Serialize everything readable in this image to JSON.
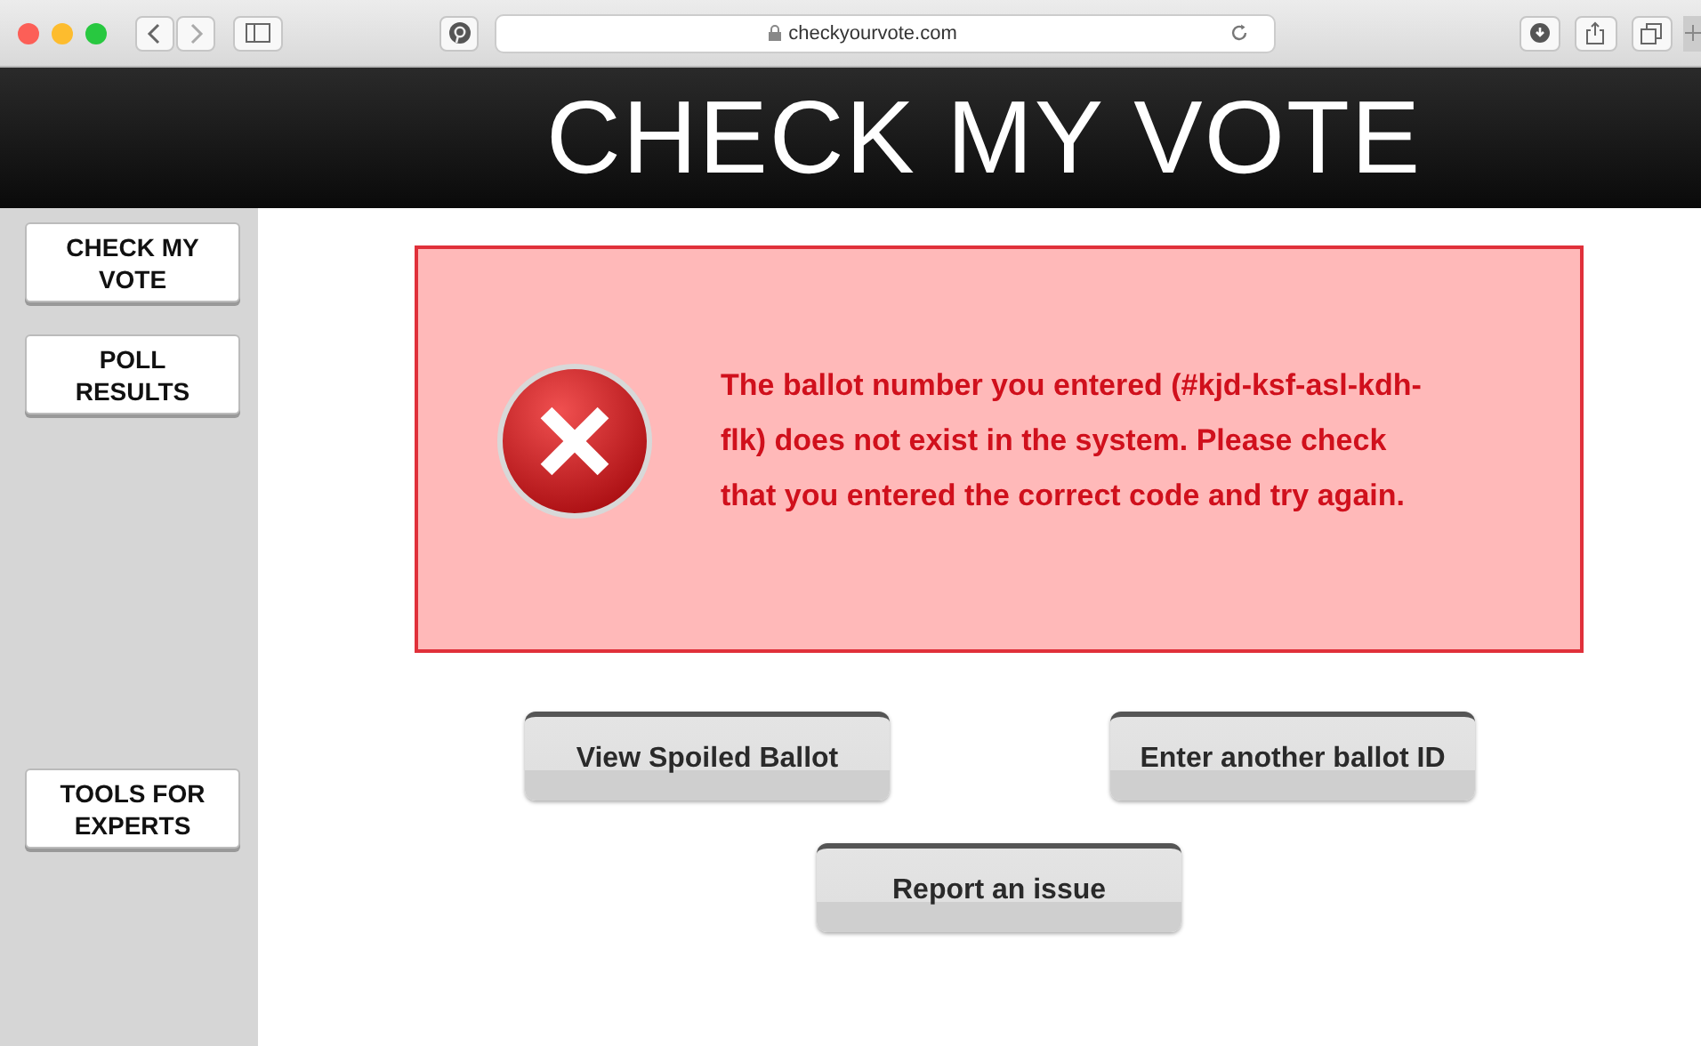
{
  "browser": {
    "url": "checkyourvote.com"
  },
  "header": {
    "title": "CHECK MY VOTE"
  },
  "sidebar": {
    "items": [
      {
        "label": "CHECK MY VOTE"
      },
      {
        "label": "POLL RESULTS"
      },
      {
        "label": "TOOLS FOR EXPERTS"
      }
    ]
  },
  "error": {
    "message": "The ballot number you entered (#kjd-ksf-asl-kdh-flk) does not exist in the system. Please check that you entered the correct code and try again."
  },
  "buttons": [
    {
      "label": "View Spoiled Ballot"
    },
    {
      "label": "Enter another ballot ID"
    },
    {
      "label": "Report an issue"
    }
  ]
}
